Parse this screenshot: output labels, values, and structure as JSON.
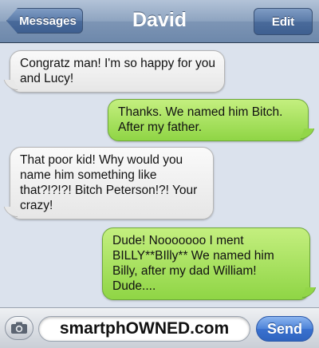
{
  "header": {
    "back_label": "Messages",
    "title": "David",
    "edit_label": "Edit"
  },
  "messages": [
    {
      "side": "received",
      "text": "Congratz man! I'm so happy for you and Lucy!"
    },
    {
      "side": "sent",
      "text": "Thanks. We named him Bitch. After my father."
    },
    {
      "side": "received",
      "text": "That poor kid! Why would you name him something like that?!?!?! Bitch Peterson!?! Your crazy!"
    },
    {
      "side": "sent",
      "text": "Dude! Nooooooo I ment BILLY**BIlly** We named him Billy, after my dad William! Dude...."
    }
  ],
  "compose": {
    "text": "smartphOWNED.com",
    "send_label": "Send"
  },
  "icons": {
    "camera": "camera-icon"
  },
  "colors": {
    "sent_bubble": "#8fd545",
    "received_bubble": "#e6e6e6",
    "background": "#dbe2ed",
    "navbar": "#7d95b5",
    "send_button": "#3a71cf"
  }
}
